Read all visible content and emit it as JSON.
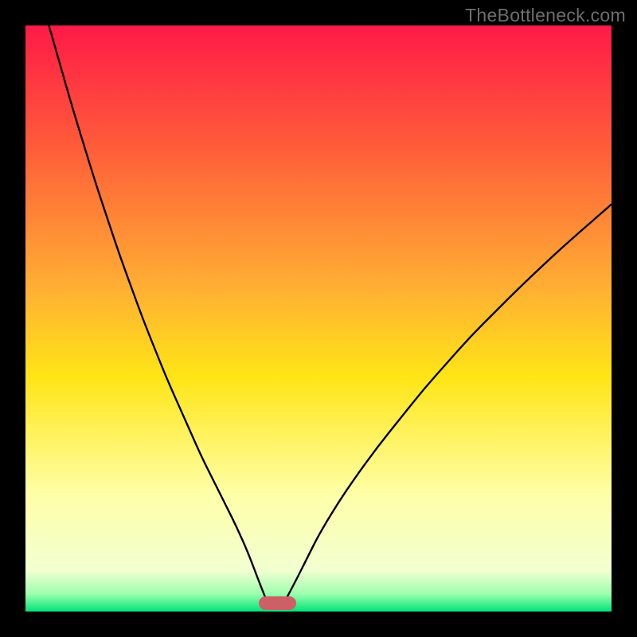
{
  "watermark": "TheBottleneck.com",
  "chart_data": {
    "type": "line",
    "title": "",
    "xlabel": "",
    "ylabel": "",
    "xlim": [
      0,
      100
    ],
    "ylim": [
      0,
      100
    ],
    "grid": false,
    "legend": false,
    "gradient_stops": [
      {
        "offset": 0,
        "color": "#ff1a47"
      },
      {
        "offset": 20,
        "color": "#ff5a3a"
      },
      {
        "offset": 45,
        "color": "#ffb033"
      },
      {
        "offset": 60,
        "color": "#ffe516"
      },
      {
        "offset": 80,
        "color": "#ffffa8"
      },
      {
        "offset": 93,
        "color": "#f2ffd0"
      },
      {
        "offset": 97,
        "color": "#9cffae"
      },
      {
        "offset": 100,
        "color": "#00e379"
      }
    ],
    "series": [
      {
        "name": "left-curve",
        "type": "line",
        "color": "#000000",
        "x": [
          4,
          6,
          8,
          10,
          12,
          14,
          16,
          18,
          20,
          22,
          24,
          26,
          28,
          30,
          32,
          34,
          36,
          38,
          39.5,
          41
        ],
        "values": [
          100,
          93,
          86,
          79.5,
          73,
          67,
          61,
          55.5,
          50,
          45,
          40,
          35.5,
          31,
          26.5,
          22.5,
          18.5,
          14.5,
          10,
          6,
          2.2
        ]
      },
      {
        "name": "right-curve",
        "type": "line",
        "color": "#000000",
        "x": [
          44.5,
          46,
          48,
          50,
          53,
          56,
          60,
          64,
          68,
          72,
          76,
          80,
          84,
          88,
          92,
          96,
          100
        ],
        "values": [
          2.2,
          5,
          9,
          13,
          18,
          22.5,
          28,
          33,
          38,
          42.5,
          47,
          51,
          55,
          58.8,
          62.5,
          66,
          69.5
        ]
      }
    ],
    "marker": {
      "name": "bottleneck-marker",
      "cx": 43,
      "cy": 1.4,
      "w": 6.3,
      "h": 2.3,
      "color": "#cd5f65"
    }
  }
}
